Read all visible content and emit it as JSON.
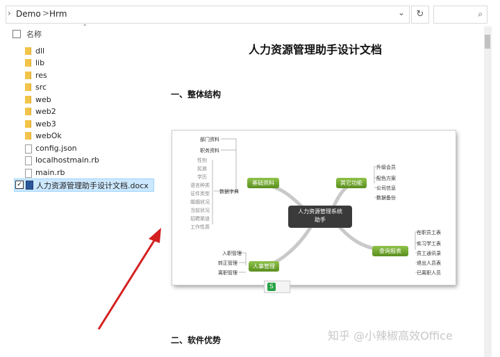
{
  "address_bar": {
    "crumbs": [
      "Demo",
      "Hrm"
    ],
    "separator": ">",
    "dropdown_icon": "chevron-down-icon",
    "refresh_icon": "refresh-icon",
    "search_icon": "search-icon"
  },
  "file_list": {
    "header_label": "名称",
    "items": [
      {
        "name": "dll",
        "type": "folder"
      },
      {
        "name": "lib",
        "type": "folder"
      },
      {
        "name": "res",
        "type": "folder"
      },
      {
        "name": "src",
        "type": "folder"
      },
      {
        "name": "web",
        "type": "folder"
      },
      {
        "name": "web2",
        "type": "folder"
      },
      {
        "name": "web3",
        "type": "folder"
      },
      {
        "name": "webOk",
        "type": "folder"
      },
      {
        "name": "config.json",
        "type": "file"
      },
      {
        "name": "localhostmain.rb",
        "type": "file"
      },
      {
        "name": "main.rb",
        "type": "file"
      },
      {
        "name": "人力资源管理助手设计文档.docx",
        "type": "docx",
        "selected": true
      }
    ]
  },
  "preview": {
    "title": "人力资源管理助手设计文档",
    "section1": "一、整体结构",
    "section2": "二、软件优势",
    "watermark": "知乎 @小辣椒高效Office",
    "mindmap": {
      "center": [
        "人力资源管理系统",
        "助手"
      ],
      "left_top_items": [
        "部门资料",
        "职务资料"
      ],
      "basic_label": "基础资料",
      "dict_label": "数据字典",
      "dict_items": [
        "性别",
        "民族",
        "学历",
        "语言种类",
        "证件类型",
        "婚姻状况",
        "当前状况",
        "招聘渠道",
        "工作性质"
      ],
      "other_label": "其它功能",
      "other_items": [
        "升级会员",
        "配色方案",
        "公司信息",
        "数据备份"
      ],
      "query_label": "查询报表",
      "query_items": [
        "在职员工表",
        "实习学工表",
        "员工通讯录",
        "退出人员表",
        "已离职人员"
      ],
      "hr_label": "人事管理",
      "hr_items": [
        "入职管理",
        "转正管理",
        "离职管理"
      ]
    }
  },
  "colors": {
    "selection_bg": "#cce8ff",
    "node_green": "#6fa52e",
    "center_node": "#3a3a3a",
    "arrow_red": "#d42020"
  }
}
